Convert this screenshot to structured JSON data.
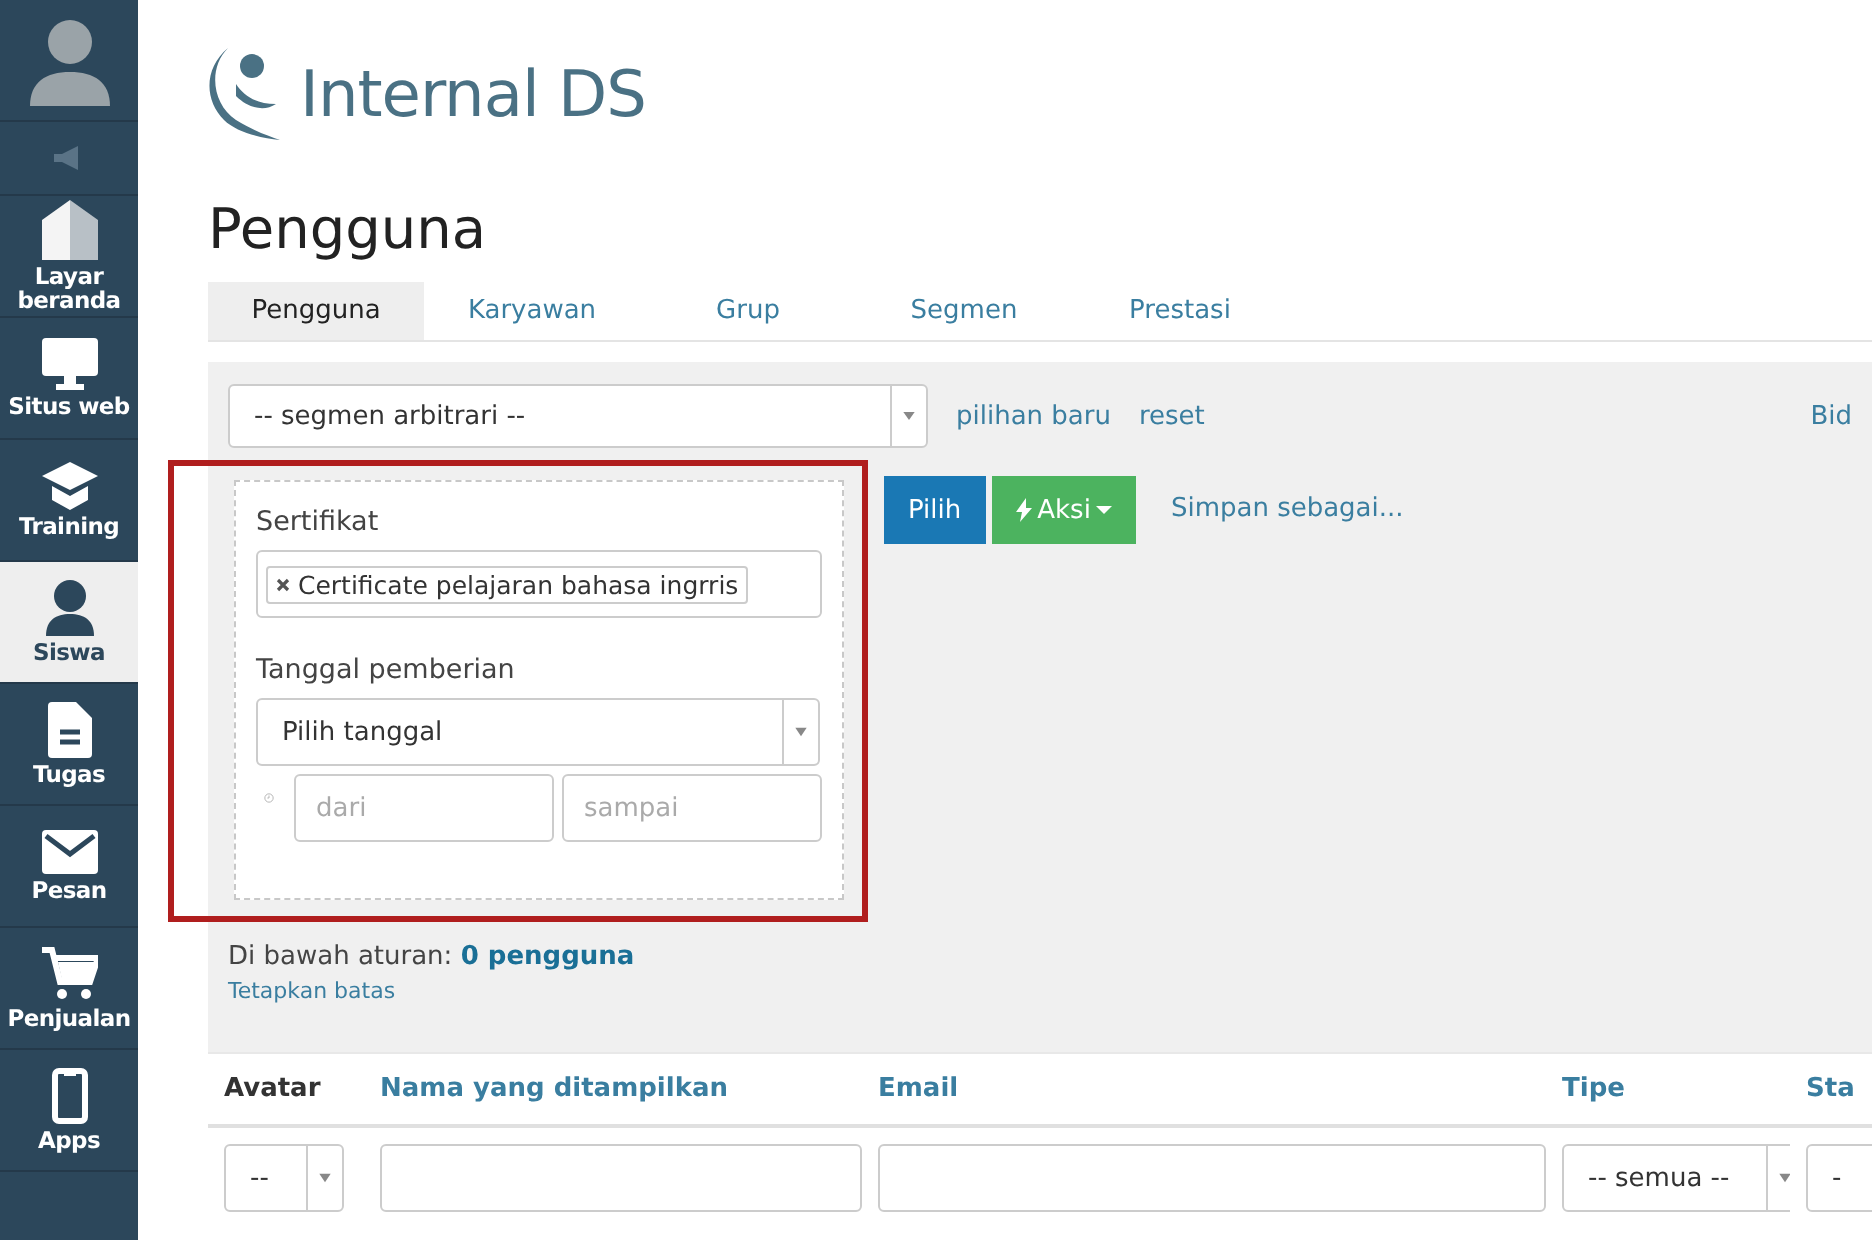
{
  "sidebar": {
    "items": [
      {
        "kind": "avatar",
        "selected": false
      },
      {
        "kind": "speaker",
        "selected": false
      },
      {
        "kind": "home",
        "label": "Layar beranda",
        "selected": false
      },
      {
        "kind": "monitor",
        "label": "Situs web",
        "selected": false
      },
      {
        "kind": "cap",
        "label": "Training",
        "selected": false
      },
      {
        "kind": "person",
        "label": "Siswa",
        "selected": true
      },
      {
        "kind": "doc",
        "label": "Tugas",
        "selected": false
      },
      {
        "kind": "mail",
        "label": "Pesan",
        "selected": false
      },
      {
        "kind": "cart",
        "label": "Penjualan",
        "selected": false
      },
      {
        "kind": "phone",
        "label": "Apps",
        "selected": false
      }
    ]
  },
  "logo": {
    "text": "Internal DS"
  },
  "page_title": "Pengguna",
  "tabs": [
    {
      "label": "Pengguna",
      "selected": true
    },
    {
      "label": "Karyawan",
      "selected": false
    },
    {
      "label": "Grup",
      "selected": false
    },
    {
      "label": "Segmen",
      "selected": false
    },
    {
      "label": "Prestasi",
      "selected": false
    }
  ],
  "segment": {
    "value": "-- segmen arbitrari --",
    "links": [
      "pilihan baru",
      "reset"
    ],
    "right_link": "Bid"
  },
  "filter": {
    "highlighted": true,
    "certificate_label": "Sertifikat",
    "certificate_tag": "Certificate pelajaran bahasa ingrris",
    "date_label": "Tanggal pemberian",
    "date_select": "Pilih tanggal",
    "from_placeholder": "dari",
    "to_placeholder": "sampai"
  },
  "actions": {
    "select_button": "Pilih",
    "action_button": "Aksi",
    "save_link": "Simpan sebagai..."
  },
  "summary": {
    "prefix": "Di bawah aturan:",
    "count": "0 pengguna",
    "limit_link": "Tetapkan batas"
  },
  "table": {
    "columns": [
      {
        "label": "Avatar",
        "sortable": false,
        "kind": "select",
        "filter_value": "--"
      },
      {
        "label": "Nama yang ditampilkan",
        "sortable": true,
        "kind": "input"
      },
      {
        "label": "Email",
        "sortable": true,
        "kind": "input"
      },
      {
        "label": "Tipe",
        "sortable": true,
        "kind": "select",
        "filter_value": "-- semua --"
      },
      {
        "label": "Sta",
        "sortable": true,
        "kind": "select",
        "filter_value": "-"
      }
    ]
  }
}
